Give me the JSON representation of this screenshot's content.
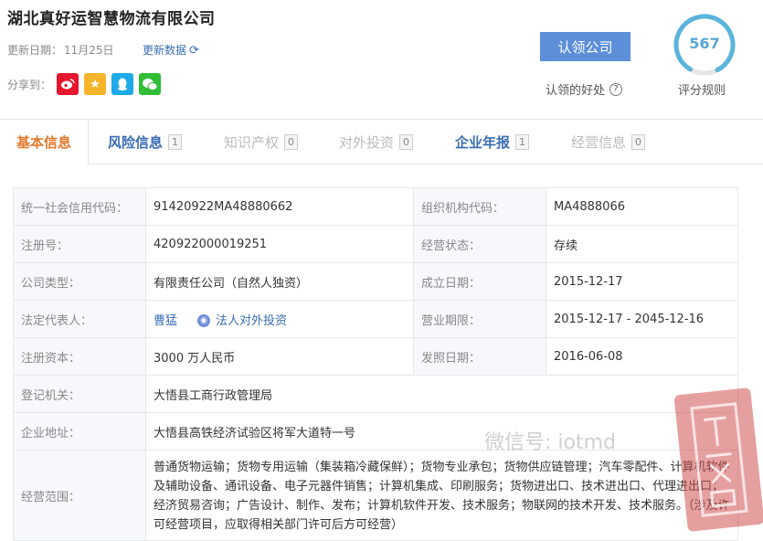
{
  "company": {
    "name": "湖北真好运智慧物流有限公司",
    "update_label": "更新日期：",
    "update_date": "11月25日",
    "update_data_link": "更新数据",
    "share_label": "分享到："
  },
  "share_icons": [
    "weibo-icon",
    "star-icon",
    "qq-icon",
    "wechat-icon"
  ],
  "claim": {
    "button": "认领公司",
    "benefit": "认领的好处",
    "score": "567",
    "score_rule": "评分规则",
    "score_fraction": 0.84,
    "ring_color": "#5ab4dc"
  },
  "tabs": [
    {
      "label": "基本信息",
      "count": ""
    },
    {
      "label": "风险信息",
      "count": "1"
    },
    {
      "label": "知识产权",
      "count": "0"
    },
    {
      "label": "对外投资",
      "count": "0"
    },
    {
      "label": "企业年报",
      "count": "1"
    },
    {
      "label": "经营信息",
      "count": "0"
    }
  ],
  "info": {
    "credit_code_label": "统一社会信用代码：",
    "credit_code": "91420922MA48880662",
    "org_code_label": "组织机构代码：",
    "org_code": "MA4888066",
    "reg_no_label": "注册号：",
    "reg_no": "420922000019251",
    "status_label": "经营状态：",
    "status": "存续",
    "type_label": "公司类型：",
    "type": "有限责任公司（自然人独资）",
    "founded_label": "成立日期：",
    "founded": "2015-12-17",
    "rep_label": "法定代表人：",
    "rep": "曹猛",
    "rep_invest": "法人对外投资",
    "term_label": "营业期限：",
    "term": "2015-12-17 - 2045-12-16",
    "capital_label": "注册资本：",
    "capital": "3000 万人民币",
    "issue_label": "发照日期：",
    "issue": "2016-06-08",
    "authority_label": "登记机关：",
    "authority": "大悟县工商行政管理局",
    "address_label": "企业地址：",
    "address": "大悟县高铁经济试验区将军大道特一号",
    "scope_label": "经营范围：",
    "scope": "普通货物运输；货物专用运输（集装箱冷藏保鲜）；货物专业承包；货物供应链管理；汽车零配件、计算机软件及辅助设备、通讯设备、电子元器件销售；计算机集成、印刷服务；货物进出口、技术进出口、代理进出口；经济贸易咨询；广告设计、制作、发布；计算机软件开发、技术服务；物联网的技术开发、技术服务。（涉及许可经营项目，应取得相关部门许可后方可经营）"
  },
  "watermark": "微信号: iotmd"
}
